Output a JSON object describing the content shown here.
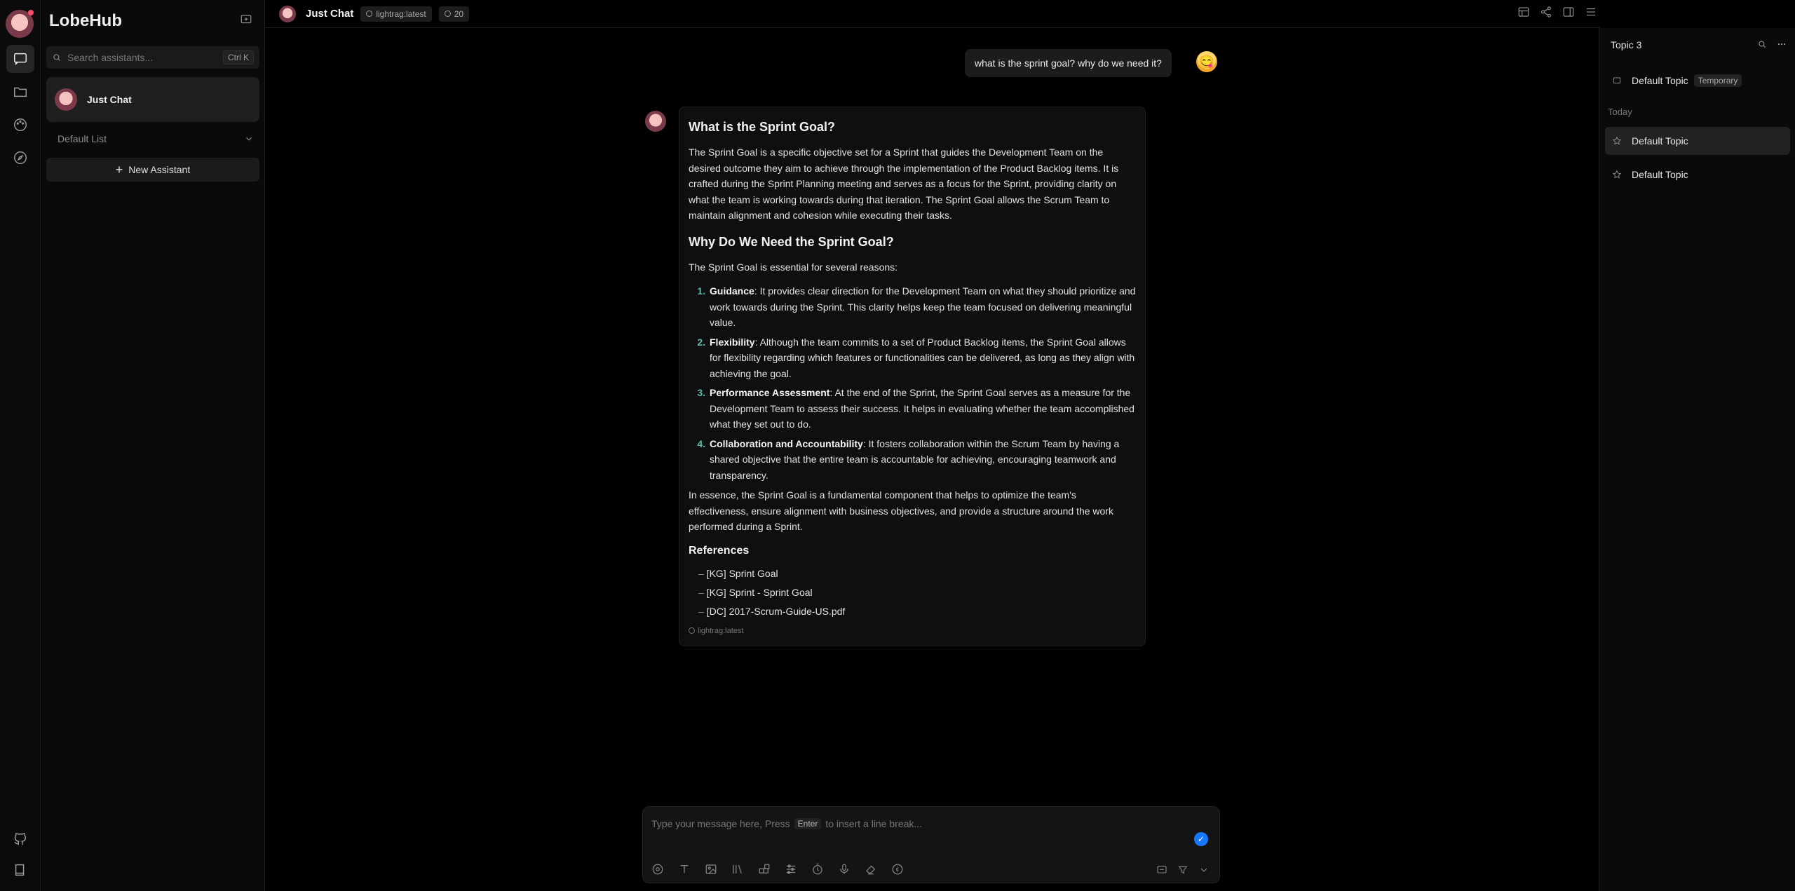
{
  "sidebar": {
    "brand": "LobeHub",
    "search_placeholder": "Search assistants...",
    "search_shortcut": "Ctrl K",
    "agent_name": "Just Chat",
    "list_label": "Default List",
    "new_assistant_label": "New Assistant"
  },
  "header": {
    "title": "Just Chat",
    "model_tag": "lightrag:latest",
    "history_count": "20"
  },
  "topics_panel": {
    "title": "Topic 3",
    "items": [
      {
        "label": "Default Topic",
        "badge": "Temporary"
      },
      {
        "label": "Default Topic"
      },
      {
        "label": "Default Topic"
      }
    ],
    "today_label": "Today"
  },
  "chat": {
    "user_message": "what is the sprint goal? why do we need it?",
    "reply": {
      "h1": "What is the Sprint Goal?",
      "p1": "The Sprint Goal is a specific objective set for a Sprint that guides the Development Team on the desired outcome they aim to achieve through the implementation of the Product Backlog items. It is crafted during the Sprint Planning meeting and serves as a focus for the Sprint, providing clarity on what the team is working towards during that iteration. The Sprint Goal allows the Scrum Team to maintain alignment and cohesion while executing their tasks.",
      "h2": "Why Do We Need the Sprint Goal?",
      "p2": "The Sprint Goal is essential for several reasons:",
      "reasons": [
        {
          "term": "Guidance",
          "text": ": It provides clear direction for the Development Team on what they should prioritize and work towards during the Sprint. This clarity helps keep the team focused on delivering meaningful value."
        },
        {
          "term": "Flexibility",
          "text": ": Although the team commits to a set of Product Backlog items, the Sprint Goal allows for flexibility regarding which features or functionalities can be delivered, as long as they align with achieving the goal."
        },
        {
          "term": "Performance Assessment",
          "text": ": At the end of the Sprint, the Sprint Goal serves as a measure for the Development Team to assess their success. It helps in evaluating whether the team accomplished what they set out to do."
        },
        {
          "term": "Collaboration and Accountability",
          "text": ": It fosters collaboration within the Scrum Team by having a shared objective that the entire team is accountable for achieving, encouraging teamwork and transparency."
        }
      ],
      "p3": "In essence, the Sprint Goal is a fundamental component that helps to optimize the team's effectiveness, ensure alignment with business objectives, and provide a structure around the work performed during a Sprint.",
      "refs_title": "References",
      "refs": [
        "[KG] Sprint Goal",
        "[KG] Sprint - Sprint Goal",
        "[DC] 2017-Scrum-Guide-US.pdf"
      ],
      "model": "lightrag:latest"
    }
  },
  "composer": {
    "placeholder_pre": "Type your message here, Press",
    "placeholder_key": "Enter",
    "placeholder_post": "to insert a line break..."
  }
}
